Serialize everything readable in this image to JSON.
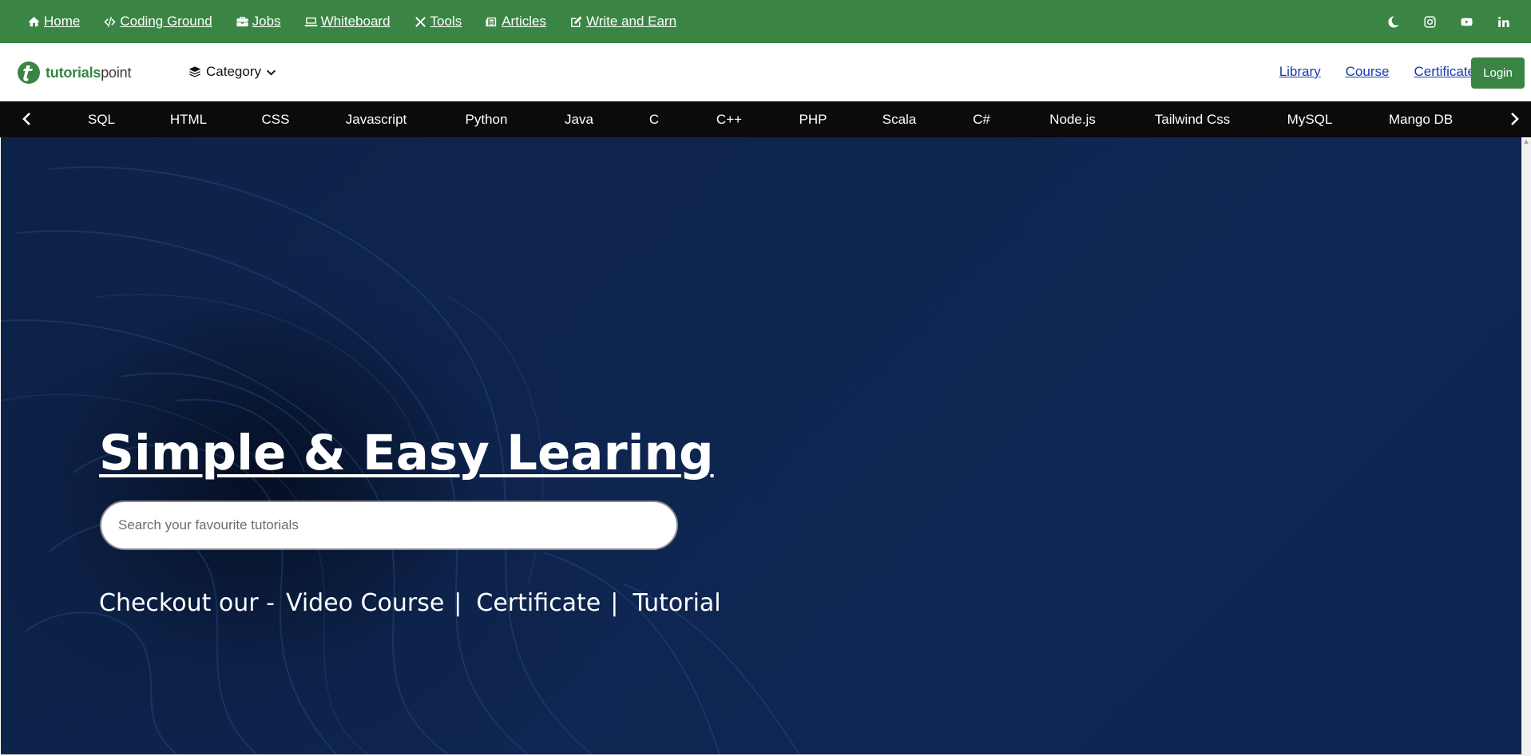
{
  "topnav": {
    "items": [
      {
        "label": " Home",
        "icon": "home-icon"
      },
      {
        "label": " Coding Ground",
        "icon": "code-icon"
      },
      {
        "label": " Jobs",
        "icon": "briefcase-icon"
      },
      {
        "label": " Whiteboard",
        "icon": "laptop-icon"
      },
      {
        "label": "Tools",
        "icon": "tools-icon"
      },
      {
        "label": "Articles",
        "icon": "newspaper-icon"
      },
      {
        "label": "Write and Earn",
        "icon": "edit-icon"
      }
    ],
    "social_icons": [
      "moon-icon",
      "instagram-icon",
      "youtube-icon",
      "linkedin-icon"
    ],
    "background": "#3a8543"
  },
  "header": {
    "logo": {
      "text_green": "tutorials",
      "text_dark": "point"
    },
    "category_label": "Category",
    "links": [
      "Library",
      "Course",
      "Certificate"
    ],
    "login_label": "Login",
    "link_color": "#1a3aa8",
    "accent": "#3a8543"
  },
  "langbar": {
    "items": [
      "SQL",
      "HTML",
      "CSS",
      "Javascript",
      "Python",
      "Java",
      "C",
      "C++",
      "PHP",
      "Scala",
      "C#",
      "Node.js",
      "Tailwind Css",
      "MySQL",
      "Mango DB"
    ],
    "background": "#0b0b0b"
  },
  "hero": {
    "title": "Simple & Easy Learing",
    "search_placeholder": "Search your favourite tutorials",
    "checkout_prefix": "Checkout our - ",
    "checkout_links": [
      "Video Course",
      "Certificate",
      "Tutorial"
    ],
    "separator": "|",
    "background": "#0e2450"
  }
}
